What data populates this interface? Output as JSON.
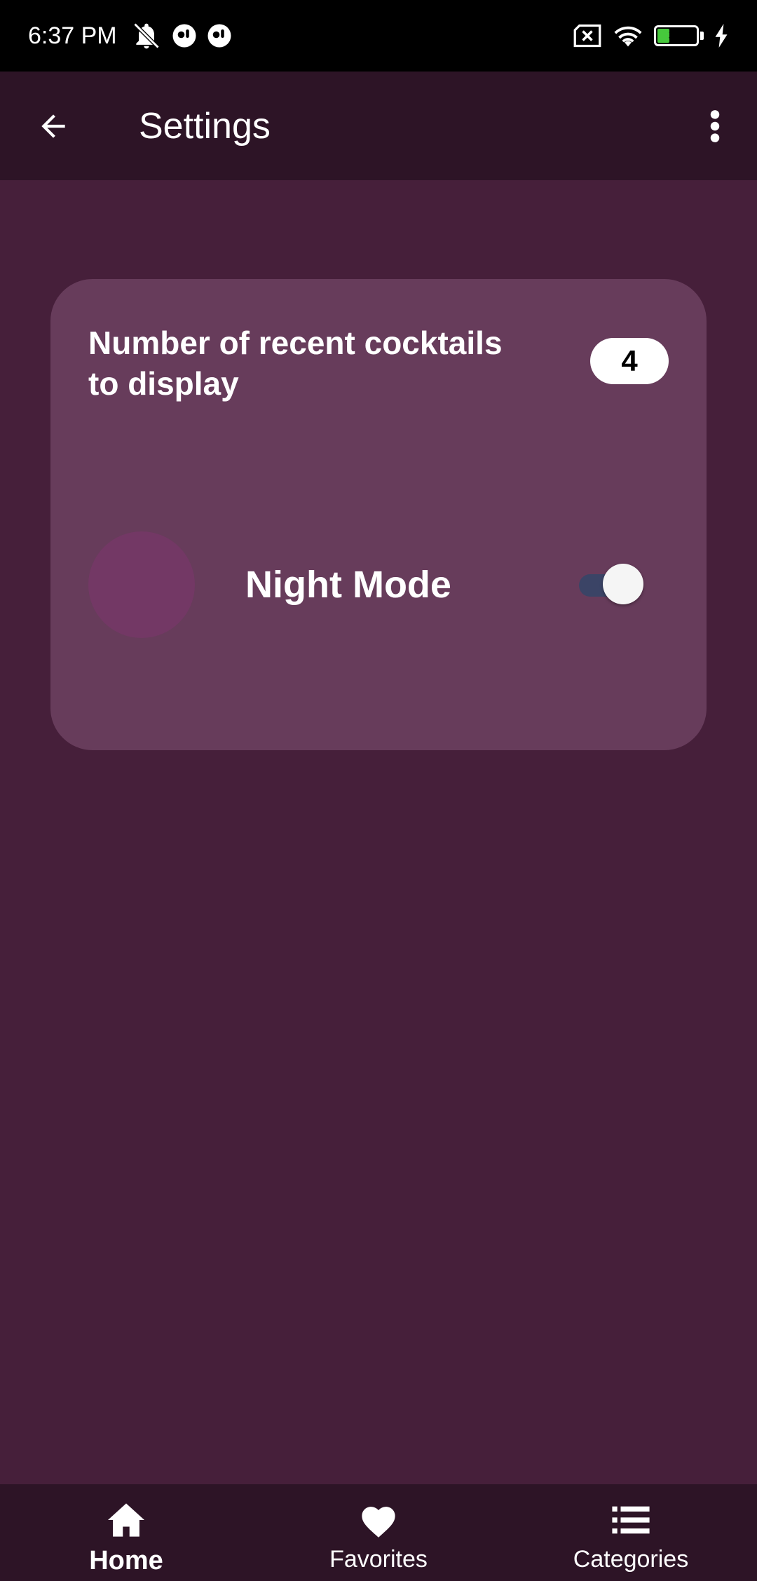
{
  "status_bar": {
    "time": "6:37 PM",
    "battery_level": "31",
    "icons": [
      "bell-off-icon",
      "app-notification-icon",
      "app-notification-icon",
      "sim-off-icon",
      "wifi-icon",
      "battery-icon",
      "charging-icon"
    ]
  },
  "app_bar": {
    "title": "Settings",
    "back_icon": "arrow-left-icon",
    "menu_icon": "more-vert-icon"
  },
  "settings": {
    "recent_cocktails": {
      "label": "Number of recent cocktails to display",
      "value": "4"
    },
    "night_mode": {
      "label": "Night Mode",
      "icon": "moon-icon",
      "enabled": true
    }
  },
  "bottom_nav": {
    "items": [
      {
        "label": "Home",
        "icon": "home-icon",
        "active": true
      },
      {
        "label": "Favorites",
        "icon": "heart-icon",
        "active": false
      },
      {
        "label": "Categories",
        "icon": "list-icon",
        "active": false
      }
    ]
  },
  "colors": {
    "background": "#461f3a",
    "app_bar": "#2d1426",
    "card": "#673c5b",
    "moon_circle": "#733865",
    "toggle_track": "#3b4466"
  }
}
